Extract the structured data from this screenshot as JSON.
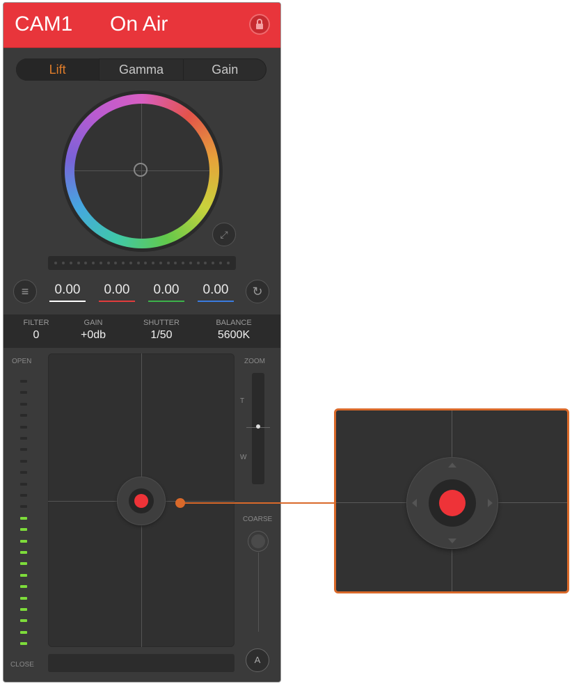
{
  "header": {
    "camera": "CAM1",
    "status": "On Air",
    "accent": "#e8353b"
  },
  "tabs": [
    {
      "label": "Lift",
      "active": true
    },
    {
      "label": "Gamma",
      "active": false
    },
    {
      "label": "Gain",
      "active": false
    }
  ],
  "color_values": [
    {
      "value": "0.00",
      "color": "#ffffff"
    },
    {
      "value": "0.00",
      "color": "#e23c3c"
    },
    {
      "value": "0.00",
      "color": "#3cb34a"
    },
    {
      "value": "0.00",
      "color": "#3a7be0"
    }
  ],
  "settings": {
    "filter": {
      "label": "FILTER",
      "value": "0"
    },
    "gain": {
      "label": "GAIN",
      "value": "+0db"
    },
    "shutter": {
      "label": "SHUTTER",
      "value": "1/50"
    },
    "balance": {
      "label": "BALANCE",
      "value": "5600K"
    }
  },
  "iris": {
    "open_label": "OPEN",
    "close_label": "CLOSE"
  },
  "zoom": {
    "label": "ZOOM",
    "tele": "T",
    "wide": "W"
  },
  "focus": {
    "coarse_label": "COARSE",
    "auto_label": "A"
  },
  "icons": [
    "lock-icon",
    "expand-icon",
    "menu-icon",
    "reset-icon",
    "auto-focus-icon"
  ],
  "callout_color": "#d9692a"
}
